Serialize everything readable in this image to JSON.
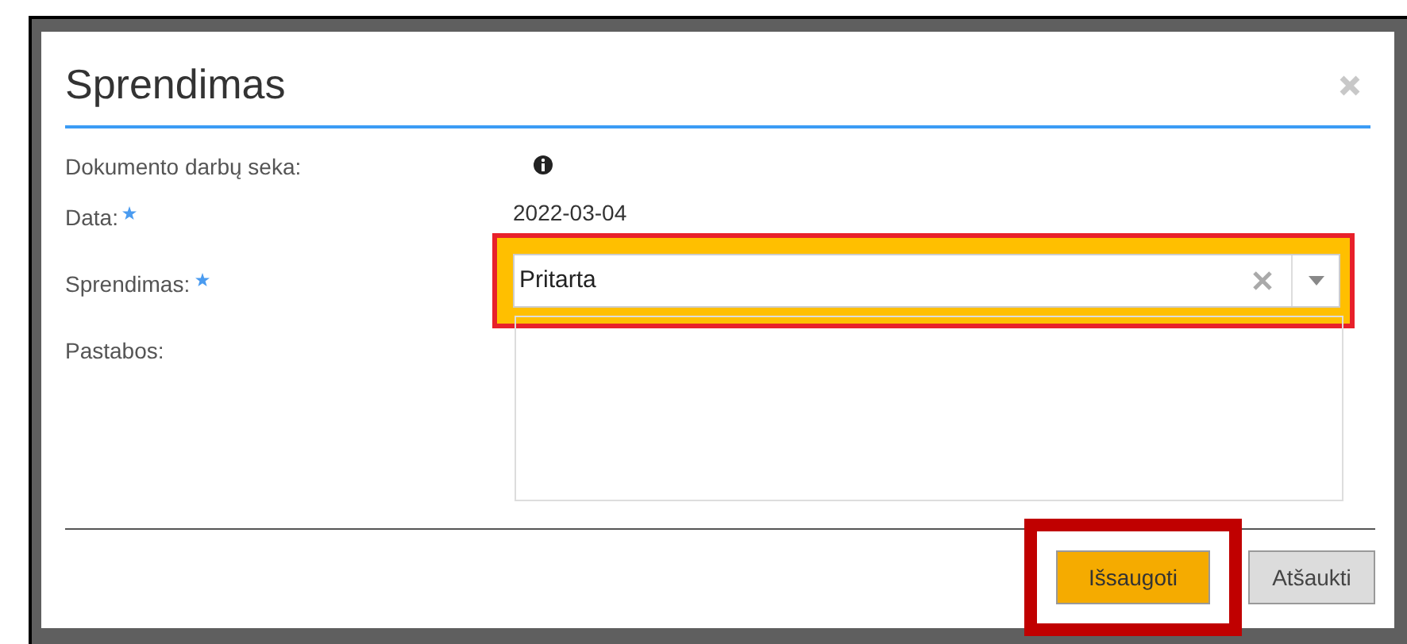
{
  "dialog": {
    "title": "Sprendimas",
    "fields": [
      {
        "kind": "info",
        "label": "Dokumento darbų seka:",
        "required": false
      },
      {
        "kind": "text",
        "label": "Data:",
        "required": true,
        "value": "2022-03-04"
      },
      {
        "kind": "select",
        "label": "Sprendimas:",
        "required": true,
        "value": "Pritarta",
        "highlighted": true
      },
      {
        "kind": "textarea",
        "label": "Pastabos:",
        "required": false
      }
    ],
    "buttons": [
      {
        "label": "Išsaugoti",
        "kind": "primary",
        "highlighted": true
      },
      {
        "label": "Atšaukti",
        "kind": "secondary",
        "highlighted": false
      }
    ]
  }
}
